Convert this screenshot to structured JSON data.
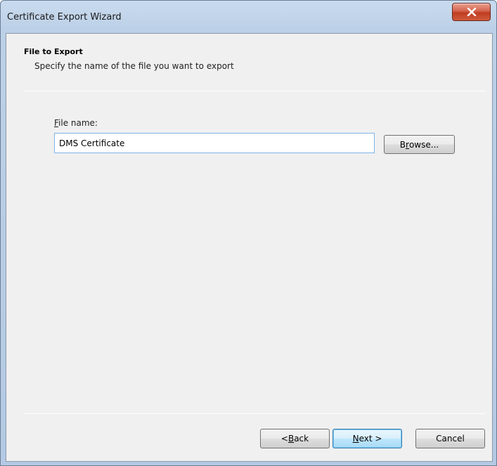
{
  "window": {
    "title": "Certificate Export Wizard"
  },
  "header": {
    "title": "File to Export",
    "subtitle": "Specify the name of the file you want to export"
  },
  "form": {
    "label_prefix": "",
    "label_mnemonic": "F",
    "label_rest": "ile name:",
    "filename_value": "DMS Certificate",
    "browse": {
      "pre": "B",
      "mnemonic": "r",
      "post": "owse..."
    }
  },
  "footer": {
    "back": {
      "pre": "< ",
      "mnemonic": "B",
      "post": "ack"
    },
    "next": {
      "pre": "",
      "mnemonic": "N",
      "post": "ext >"
    },
    "cancel_label": "Cancel"
  },
  "colors": {
    "close_button": "#c13d22",
    "default_button_border": "#3c7fb1",
    "input_focus_border": "#7eb4ea"
  },
  "icons": {
    "close": "close-icon"
  }
}
